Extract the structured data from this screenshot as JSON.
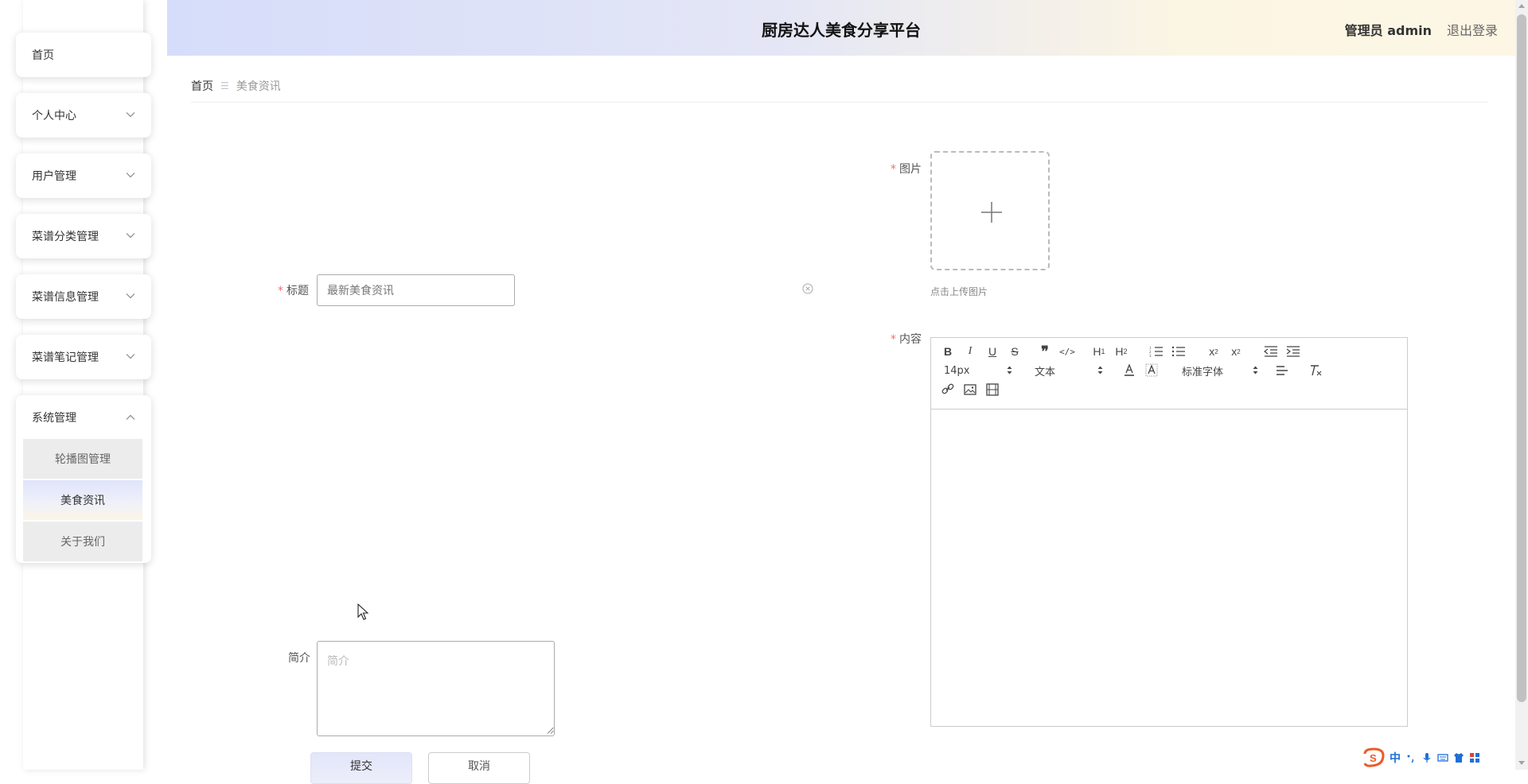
{
  "header": {
    "title": "厨房达人美食分享平台",
    "user": "管理员 admin",
    "logout": "退出登录"
  },
  "sidebar": {
    "items": [
      {
        "label": "首页"
      },
      {
        "label": "个人中心"
      },
      {
        "label": "用户管理"
      },
      {
        "label": "菜谱分类管理"
      },
      {
        "label": "菜谱信息管理"
      },
      {
        "label": "菜谱笔记管理"
      }
    ],
    "expanded": {
      "label": "系统管理",
      "children": [
        {
          "label": "轮播图管理"
        },
        {
          "label": "美食资讯"
        },
        {
          "label": "关于我们"
        }
      ]
    }
  },
  "breadcrumb": {
    "home": "首页",
    "current": "美食资讯"
  },
  "form": {
    "title_label": "标题",
    "title_value": "最新美食资讯",
    "image_label": "图片",
    "image_tip": "点击上传图片",
    "content_label": "内容",
    "intro_label": "简介",
    "intro_placeholder": "简介",
    "submit": "提交",
    "cancel": "取消"
  },
  "editor": {
    "font_size": "14px",
    "paragraph": "文本",
    "font_family": "标准字体"
  },
  "ime": {
    "mode": "中"
  },
  "colors": {
    "required": "#f56c6c",
    "accent_gradient_start": "#d6ddfa",
    "accent_gradient_end": "#fdf6e4"
  }
}
